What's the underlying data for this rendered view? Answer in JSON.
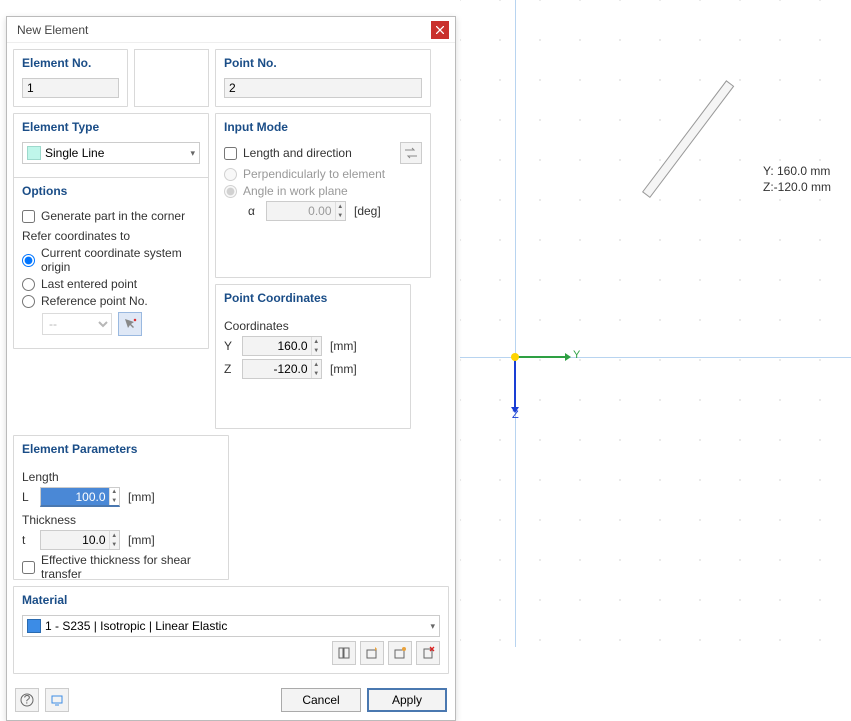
{
  "dialog": {
    "title": "New Element"
  },
  "elementNo": {
    "header": "Element No.",
    "value": "1"
  },
  "pointNo": {
    "header": "Point No.",
    "value": "2"
  },
  "elementType": {
    "header": "Element Type",
    "selected": "Single Line"
  },
  "inputMode": {
    "header": "Input Mode",
    "lengthDir": "Length and direction",
    "perp": "Perpendicularly to element",
    "angle": "Angle in work plane",
    "alpha_label": "α",
    "alpha_value": "0.00",
    "alpha_unit": "[deg]"
  },
  "options": {
    "header": "Options",
    "genPart": "Generate part in the corner",
    "referHdr": "Refer coordinates to",
    "r1": "Current coordinate system origin",
    "r2": "Last entered point",
    "r3": "Reference point No.",
    "refSel": "--"
  },
  "pointCoords": {
    "header": "Point Coordinates",
    "coordsHdr": "Coordinates",
    "y_label": "Y",
    "y_value": "160.0",
    "z_label": "Z",
    "z_value": "-120.0",
    "unit": "[mm]"
  },
  "elemParams": {
    "header": "Element Parameters",
    "lengthHdr": "Length",
    "l_label": "L",
    "l_value": "100.0",
    "thickHdr": "Thickness",
    "t_label": "t",
    "t_value": "10.0",
    "unit": "[mm]",
    "effThk": "Effective thickness for shear transfer"
  },
  "material": {
    "header": "Material",
    "selected": "1 - S235 | Isotropic | Linear Elastic"
  },
  "footer": {
    "cancel": "Cancel",
    "apply": "Apply"
  },
  "readout": {
    "y": "Y: 160.0 mm",
    "z": "Z:-120.0 mm"
  },
  "axis": {
    "y": "Y",
    "z": "Z"
  }
}
